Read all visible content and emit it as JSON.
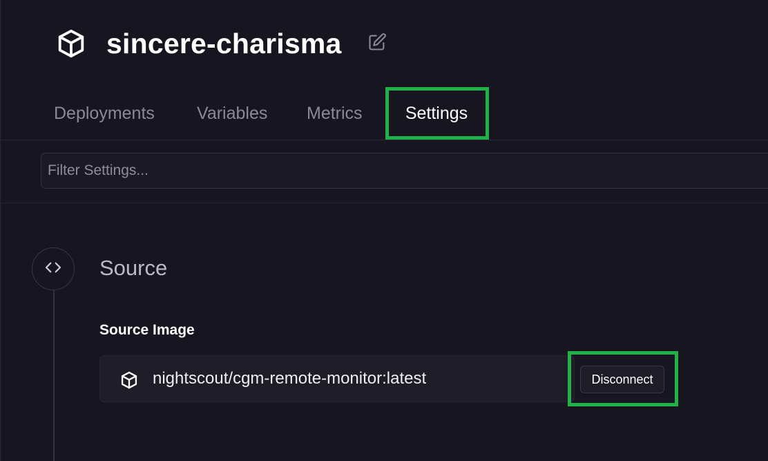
{
  "project": {
    "name": "sincere-charisma",
    "icon": "cube-icon",
    "edit_icon": "edit-icon"
  },
  "tabs": [
    {
      "label": "Deployments",
      "active": false
    },
    {
      "label": "Variables",
      "active": false
    },
    {
      "label": "Metrics",
      "active": false
    },
    {
      "label": "Settings",
      "active": true
    }
  ],
  "filter": {
    "value": "",
    "placeholder": "Filter Settings..."
  },
  "source": {
    "section_icon": "code-icon",
    "title": "Source",
    "image_label": "Source Image",
    "image_icon": "cube-icon",
    "image_name": "nightscout/cgm-remote-monitor:latest",
    "disconnect_label": "Disconnect"
  },
  "colors": {
    "background": "#17151f",
    "highlight": "#21b14b",
    "text_primary": "#ffffff",
    "text_muted": "#8c8899"
  }
}
